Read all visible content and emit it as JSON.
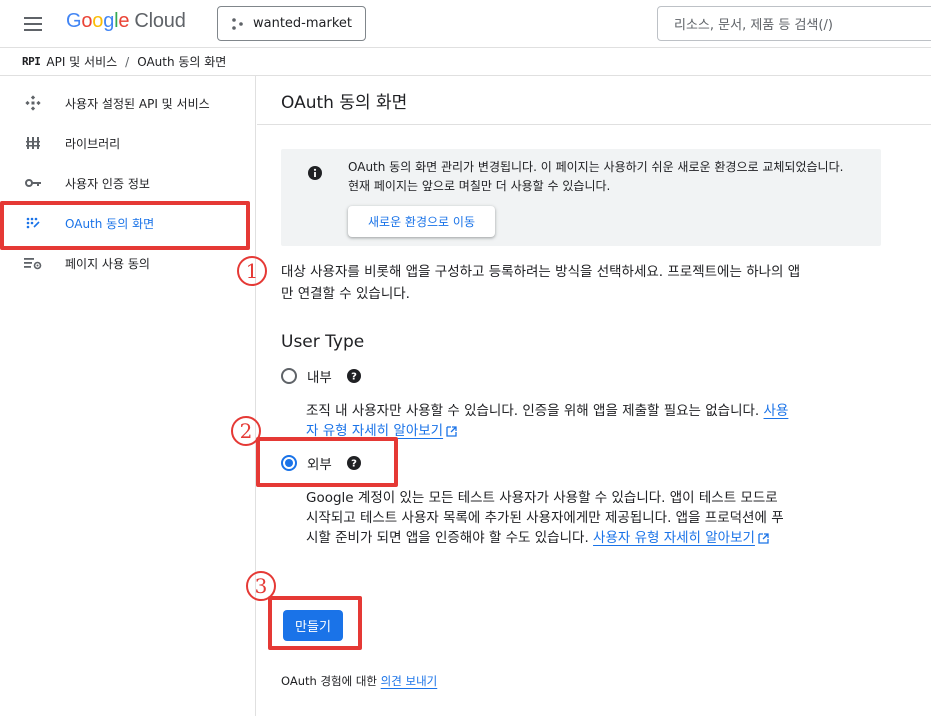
{
  "header": {
    "logo_google": [
      "G",
      "o",
      "o",
      "g",
      "l",
      "e"
    ],
    "logo_cloud": "Cloud",
    "project_name": "wanted-market",
    "search_placeholder": "리소스, 문서, 제품 등 검색(/)"
  },
  "breadcrumb": {
    "api_logo": "RPI",
    "section": "API 및 서비스",
    "separator": "/",
    "current": "OAuth 동의 화면"
  },
  "sidebar": {
    "items": [
      {
        "label": "사용자 설정된 API 및 서비스",
        "icon": "api-services-icon"
      },
      {
        "label": "라이브러리",
        "icon": "library-icon"
      },
      {
        "label": "사용자 인증 정보",
        "icon": "key-icon"
      },
      {
        "label": "OAuth 동의 화면",
        "icon": "oauth-consent-icon",
        "active": true
      },
      {
        "label": "페이지 사용 동의",
        "icon": "page-usage-settings-icon"
      }
    ]
  },
  "main": {
    "title": "OAuth 동의 화면",
    "notice": {
      "text": "OAuth 동의 화면 관리가 변경됩니다. 이 페이지는 사용하기 쉬운 새로운 환경으로 교체되었습니다. 현재 페이지는 앞으로 며칠만 더 사용할 수 있습니다.",
      "button_label": "새로운 환경으로 이동"
    },
    "description": "대상 사용자를 비롯해 앱을 구성하고 등록하려는 방식을 선택하세요. 프로젝트에는 하나의 앱만 연결할 수 있습니다.",
    "user_type_heading": "User Type",
    "options": [
      {
        "label": "내부",
        "checked": false,
        "desc": "조직 내 사용자만 사용할 수 있습니다. 인증을 위해 앱을 제출할 필요는 없습니다.",
        "link": "사용자 유형 자세히 알아보기"
      },
      {
        "label": "외부",
        "checked": true,
        "desc": "Google 계정이 있는 모든 테스트 사용자가 사용할 수 있습니다. 앱이 테스트 모드로 시작되고 테스트 사용자 목록에 추가된 사용자에게만 제공됩니다. 앱을 프로덕션에 푸시할 준비가 되면 앱을 인증해야 할 수도 있습니다.",
        "link": "사용자 유형 자세히 알아보기"
      }
    ],
    "create_button": "만들기",
    "feedback_prefix": "OAuth 경험에 대한",
    "feedback_link": "의견 보내기"
  },
  "annotations": {
    "marks": [
      "1",
      "2",
      "3"
    ],
    "color": "#e53935"
  },
  "colors": {
    "accent": "#1a73e8",
    "active_bg": "#e8f0fe",
    "notice_bg": "#f1f3f4"
  }
}
